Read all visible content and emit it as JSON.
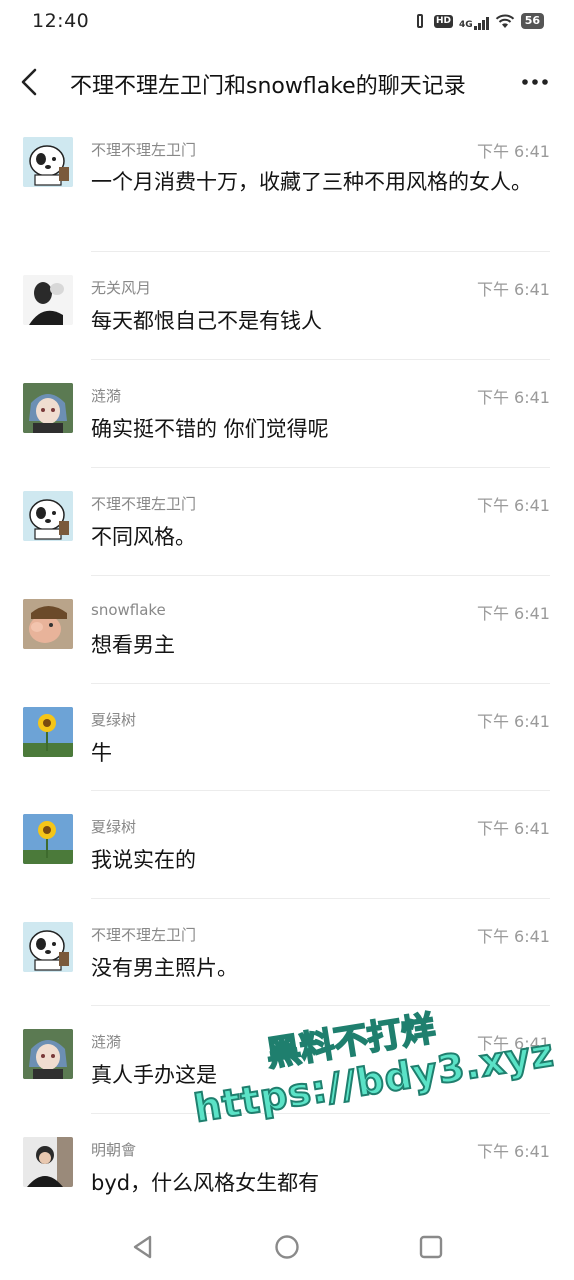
{
  "status": {
    "time": "12:40",
    "hd": "HD",
    "network": "4G",
    "battery": "56"
  },
  "header": {
    "title": "不理不理左卫门和snowflake的聊天记录"
  },
  "messages": [
    {
      "sender": "不理不理左卫门",
      "time": "下午 6:41",
      "text": "一个月消费十万，收藏了三种不用风格的女人。",
      "avatar": "cartoon-dog-avatar"
    },
    {
      "sender": "无关风月",
      "time": "下午 6:41",
      "text": "每天都恨自己不是有钱人",
      "avatar": "person-photo-avatar"
    },
    {
      "sender": "涟漪",
      "time": "下午 6:41",
      "text": "确实挺不错的 你们觉得呢",
      "avatar": "anime-girl-avatar"
    },
    {
      "sender": "不理不理左卫门",
      "time": "下午 6:41",
      "text": "不同风格。",
      "avatar": "cartoon-dog-avatar"
    },
    {
      "sender": "snowflake",
      "time": "下午 6:41",
      "text": "想看男主",
      "avatar": "cartoon-face-avatar"
    },
    {
      "sender": "夏绿树",
      "time": "下午 6:41",
      "text": "牛",
      "avatar": "sunflower-avatar"
    },
    {
      "sender": "夏绿树",
      "time": "下午 6:41",
      "text": "我说实在的",
      "avatar": "sunflower-avatar"
    },
    {
      "sender": "不理不理左卫门",
      "time": "下午 6:41",
      "text": "没有男主照片。",
      "avatar": "cartoon-dog-avatar"
    },
    {
      "sender": "涟漪",
      "time": "下午 6:41",
      "text": "真人手办这是",
      "avatar": "anime-girl-avatar"
    },
    {
      "sender": "明朝會",
      "time": "下午 6:41",
      "text": "byd，什么风格女生都有",
      "avatar": "person-photo-avatar"
    }
  ],
  "watermark": {
    "line1": "黑料不打烊",
    "line2": "https://bdy3.xyz"
  },
  "colors": {
    "watermark_fill": "#5be3c7",
    "separator": "#ececec",
    "secondary_text": "#888888"
  }
}
